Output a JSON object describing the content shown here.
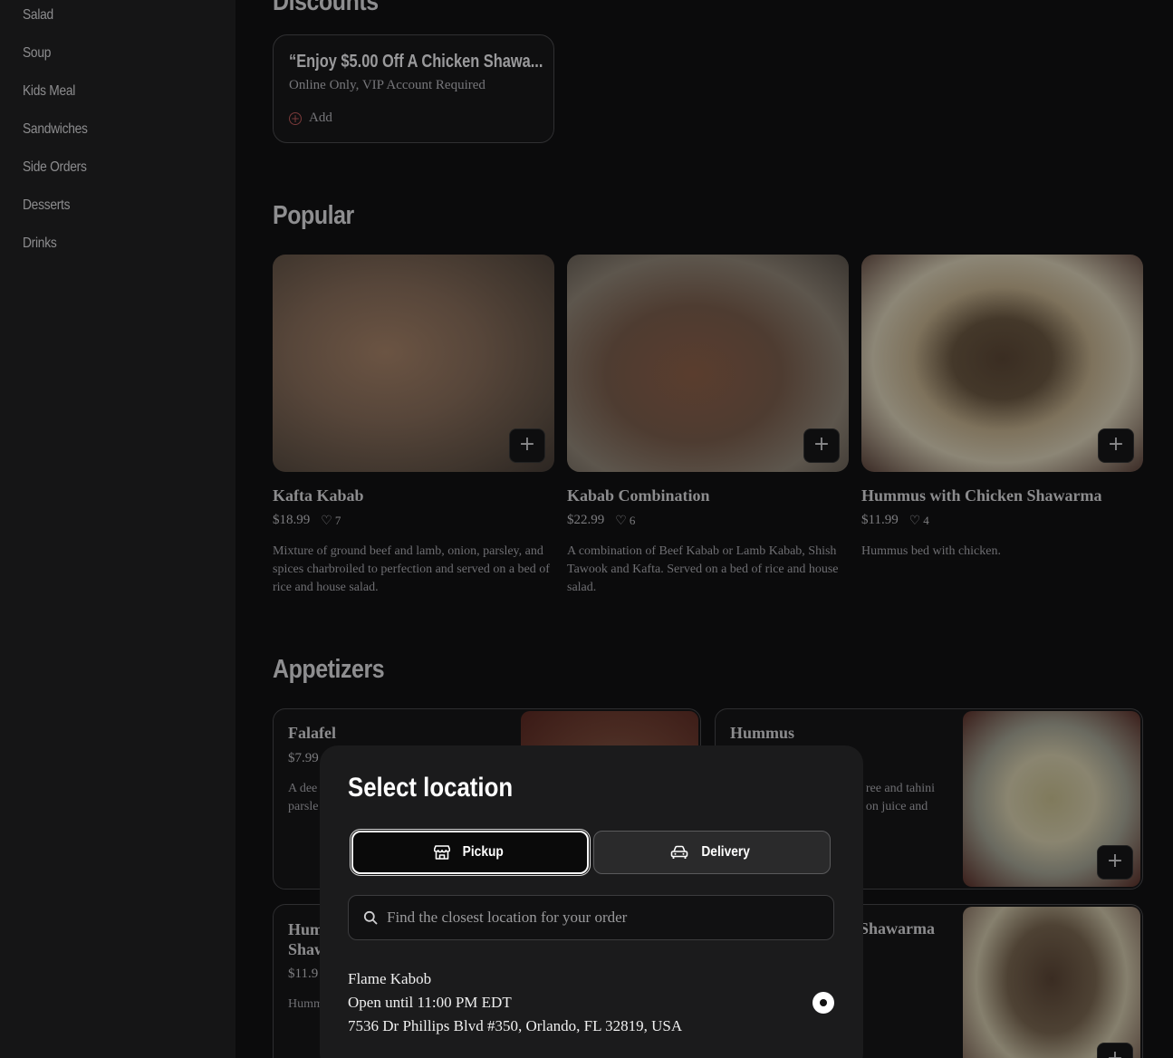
{
  "sidebar": {
    "items": [
      "Salad",
      "Soup",
      "Kids Meal",
      "Sandwiches",
      "Side Orders",
      "Desserts",
      "Drinks"
    ]
  },
  "discounts": {
    "title": "Discounts",
    "card": {
      "title": "“Enjoy $5.00 Off A Chicken Shawa...",
      "subtitle": "Online Only, VIP Account Required",
      "add_label": "Add"
    }
  },
  "popular": {
    "title": "Popular",
    "items": [
      {
        "name": "Kafta Kabab",
        "price": "$18.99",
        "likes": "7",
        "desc": "Mixture of ground beef and lamb, onion, parsley, and spices charbroiled to perfection and served on a bed of rice and house salad."
      },
      {
        "name": "Kabab Combination",
        "price": "$22.99",
        "likes": "6",
        "desc": "A combination of Beef Kabab or Lamb Kabab, Shish Tawook and Kafta. Served on a bed of rice and house salad."
      },
      {
        "name": "Hummus with Chicken Shawarma",
        "price": "$11.99",
        "likes": "4",
        "desc": "Hummus bed with chicken."
      }
    ]
  },
  "appetizers": {
    "title": "Appetizers",
    "items": [
      {
        "name": "Falafel",
        "price": "$7.99",
        "desc_line1": "A dee",
        "desc_line2": "parsle"
      },
      {
        "name": "Hummus",
        "desc_line1": "ree and tahini",
        "desc_line2": "on juice and"
      },
      {
        "name_line1": "Hum",
        "name_line2": "Shaw",
        "price": "$11.9",
        "desc": "Humm"
      },
      {
        "name": "Shawarma"
      }
    ]
  },
  "modal": {
    "title": "Select location",
    "pickup_label": "Pickup",
    "delivery_label": "Delivery",
    "search_placeholder": "Find the closest location for your order",
    "location": {
      "name": "Flame Kabob",
      "hours": "Open until 11:00 PM EDT",
      "address": "7536 Dr Phillips Blvd #350, Orlando, FL 32819, USA"
    }
  },
  "icons": {
    "add": "plus-icon",
    "like": "heart-icon",
    "pickup": "store-icon",
    "delivery": "car-icon",
    "search": "search-icon"
  }
}
